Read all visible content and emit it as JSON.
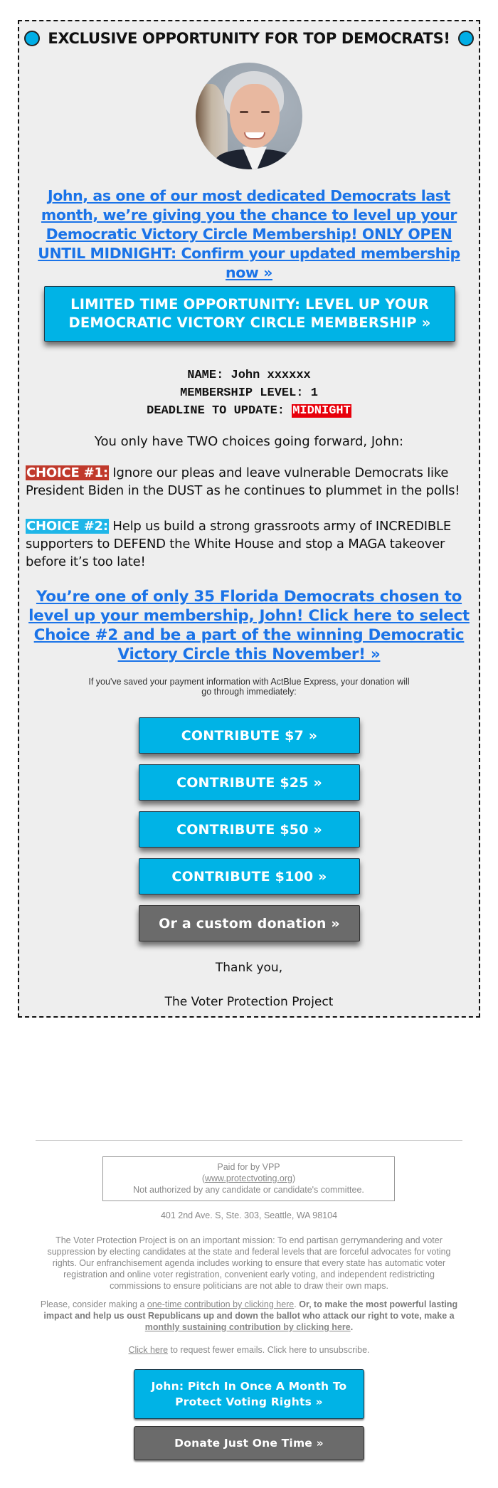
{
  "colors": {
    "accent_blue": "#00b3e6",
    "link_blue": "#1a73e8",
    "choice1_red": "#c0392b",
    "deadline_red": "#e8000b",
    "gray_button": "#6b6b6b",
    "box_background": "#eeeeee"
  },
  "header": {
    "left_icon": "blue-circle-icon",
    "title": "EXCLUSIVE OPPORTUNITY FOR TOP DEMOCRATS!",
    "right_icon": "blue-circle-icon"
  },
  "photo": {
    "alt": "President Biden portrait"
  },
  "lead_link": "John, as one of our most dedicated Democrats last month, we’re giving you the chance to level up your Democratic Victory Circle Membership! ONLY OPEN UNTIL MIDNIGHT: Confirm your updated membership now »",
  "main_button": "LIMITED TIME OPPORTUNITY: LEVEL UP YOUR DEMOCRATIC VICTORY CIRCLE MEMBERSHIP »",
  "membership": {
    "name_label": "NAME:",
    "name_value": "John xxxxxx",
    "level_label": "MEMBERSHIP LEVEL:",
    "level_value": "1",
    "deadline_label": "DEADLINE TO UPDATE:",
    "deadline_value": "MIDNIGHT"
  },
  "choices_intro": "You only have TWO choices going forward, John:",
  "choices": [
    {
      "tag": "CHOICE #1:",
      "text": " Ignore our pleas and leave vulnerable Democrats like President Biden in the DUST as he continues to plummet in the polls!"
    },
    {
      "tag": "CHOICE #2:",
      "text": " Help us build a strong grassroots army of INCREDIBLE supporters to DEFEND the White House and stop a MAGA takeover before it’s too late!"
    }
  ],
  "second_link": "You’re one of only 35 Florida Democrats chosen to level up your membership, John! Click here to select Choice #2 and be a part of the winning Democratic Victory Circle this November! »",
  "actblue_note": "If you've saved your payment information with ActBlue Express, your donation will go through immediately:",
  "donate_buttons": [
    {
      "label": "CONTRIBUTE $7 »",
      "amount": 7
    },
    {
      "label": "CONTRIBUTE $25 »",
      "amount": 25
    },
    {
      "label": "CONTRIBUTE $50 »",
      "amount": 50
    },
    {
      "label": "CONTRIBUTE $100 »",
      "amount": 100
    }
  ],
  "custom_button": "Or a custom donation »",
  "signoff": {
    "thanks": "Thank you,",
    "org": "The Voter Protection Project"
  },
  "footer": {
    "paid_for": "Paid for by VPP",
    "website_open": "(",
    "website": "www.protectvoting.org",
    "website_close": ")",
    "not_authorized": "Not authorized by any candidate or candidate's committee.",
    "address": "401 2nd Ave. S, Ste. 303, Seattle, WA 98104",
    "mission": "The Voter Protection Project is on an important mission: To end partisan gerrymandering and voter suppression by electing candidates at the state and federal levels that are forceful advocates for voting rights. Our enfranchisement agenda includes working to ensure that every state has automatic voter registration and online voter registration, convenient early voting, and independent redistricting commissions to ensure politicians are not able to draw their own maps.",
    "consider_prefix": "Please, consider making a ",
    "one_time_link": "one-time contribution by clicking here",
    "consider_mid": ". ",
    "bold_text": "Or, to make the most powerful lasting impact and help us oust Republicans up and down the ballot who attack our right to vote, make a ",
    "monthly_link": "monthly sustaining contribution by clicking here",
    "bold_end": ".",
    "fewer_link": "Click here",
    "fewer_text": " to request fewer emails. Click here to unsubscribe.",
    "monthly_button": "John: Pitch In Once A Month To Protect Voting Rights »",
    "one_time_button": "Donate Just One Time »"
  }
}
